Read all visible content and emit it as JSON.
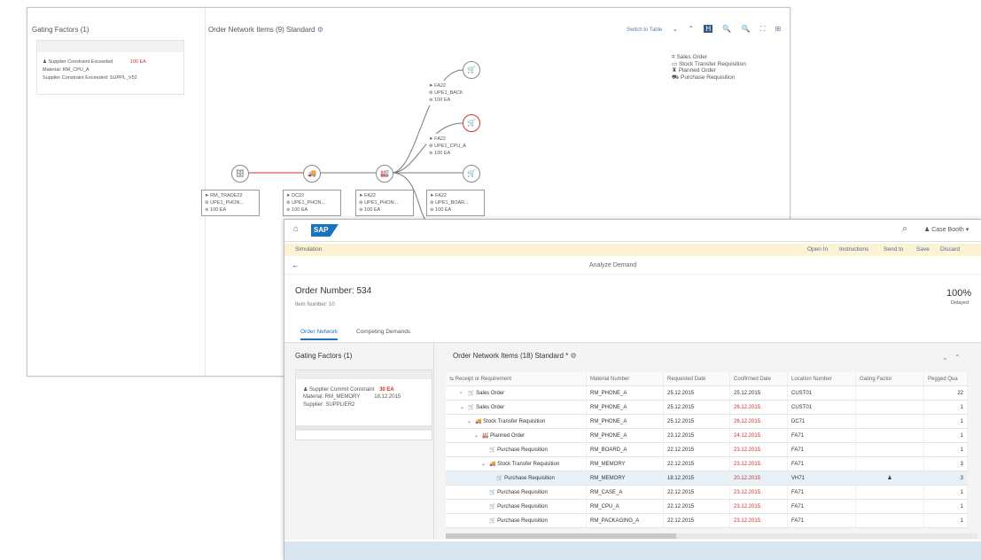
{
  "back": {
    "gating_title": "Gating Factors (1)",
    "gating_item": {
      "line1": "Supplier Constraint Exceeded",
      "value": "100 EA",
      "line2": "Material: RM_CPU_A",
      "line3": "Supplier Constraint Exceeded: SUPPL_V52"
    },
    "network_title": "Order Network Items (9)   Standard",
    "tools": [
      "Switch to Table",
      "⌄",
      "⌃",
      "H",
      "🔍",
      "🔍",
      "⛶",
      "⊞"
    ],
    "legend": [
      "Sales Order",
      "Stock Transfer Requisition",
      "Planned Order",
      "Purchase Requisition"
    ],
    "nodes": [
      {
        "icon": "🗄",
        "loc": "RM_TRADE22",
        "mat": "UPE1_PHON...",
        "qty": "100 EA"
      },
      {
        "icon": "🚚",
        "loc": "DC22",
        "mat": "UPE1_PHON...",
        "qty": "100 EA"
      },
      {
        "icon": "🏭",
        "loc": "FA22",
        "mat": "UPE1_PHON...",
        "qty": "100 EA"
      },
      {
        "icon": "🛒",
        "loc": "FA22",
        "mat": "UPE1_BACK",
        "qty": "100 EA"
      },
      {
        "icon": "🛒",
        "loc": "FA22",
        "mat": "UPE1_CPU_A",
        "qty": "100 EA"
      },
      {
        "icon": "🛒",
        "loc": "FA22",
        "mat": "UPE1_BOAR...",
        "qty": "100 EA"
      }
    ]
  },
  "front": {
    "user": "Case Booth",
    "subbar_left": "Simulation",
    "subbar_actions": [
      "Open In",
      "Instructions",
      "Send to",
      "Save",
      "Discard"
    ],
    "page_title": "Analyze Demand",
    "order_number": "Order Number: 534",
    "item_number": "Item Number: 10",
    "percent": "100%",
    "percent_label": "Delayed",
    "tabs": [
      "Order Network",
      "Competing Demands"
    ],
    "gating_title": "Gating Factors (1)",
    "gating_item": {
      "line1": "Supplier Commit Constraint",
      "value": "30 EA",
      "line2": "Material: RM_MEMORY",
      "date": "18.12.2015",
      "line3": "Supplier: SUPPLIER2"
    },
    "network_title": "Order Network Items (18)   Standard *",
    "table": {
      "headers": [
        "Receipt or Requirement",
        "Material Number",
        "Requested Date",
        "Confirmed Date",
        "Location Number",
        "Gating Factor",
        "Pegged Qua"
      ],
      "rows": [
        {
          "indent": 1,
          "exp": "›",
          "icon": "🛒",
          "name": "Sales Order",
          "mat": "RM_PHONE_A",
          "req": "25.12.2015",
          "conf": "25.12.2015",
          "red": false,
          "loc": "CUST01",
          "gate": "",
          "qty": "22"
        },
        {
          "indent": 1,
          "exp": "⌄",
          "icon": "🛒",
          "name": "Sales Order",
          "mat": "RM_PHONE_A",
          "req": "25.12.2015",
          "conf": "26.12.2015",
          "red": true,
          "loc": "CUST01",
          "gate": "",
          "qty": "1"
        },
        {
          "indent": 2,
          "exp": "⌄",
          "icon": "🚚",
          "name": "Stock Transfer Requisition",
          "mat": "RM_PHONE_A",
          "req": "25.12.2015",
          "conf": "26.12.2015",
          "red": true,
          "loc": "DC71",
          "gate": "",
          "qty": "1"
        },
        {
          "indent": 3,
          "exp": "⌄",
          "icon": "🏭",
          "name": "Planned Order",
          "mat": "RM_PHONE_A",
          "req": "23.12.2015",
          "conf": "24.12.2015",
          "red": true,
          "loc": "FA71",
          "gate": "",
          "qty": "1"
        },
        {
          "indent": 4,
          "exp": "",
          "icon": "🛒",
          "name": "Purchase Requisition",
          "mat": "RM_BOARD_A",
          "req": "22.12.2015",
          "conf": "23.12.2015",
          "red": true,
          "loc": "FA71",
          "gate": "",
          "qty": "1"
        },
        {
          "indent": 4,
          "exp": "⌄",
          "icon": "🚚",
          "name": "Stock Transfer Requisition",
          "mat": "RM_MEMORY",
          "req": "22.12.2015",
          "conf": "23.12.2015",
          "red": true,
          "loc": "FA71",
          "gate": "",
          "qty": "3"
        },
        {
          "indent": 5,
          "exp": "",
          "icon": "🛒",
          "name": "Purchase Requisition",
          "mat": "RM_MEMORY",
          "req": "18.12.2015",
          "conf": "20.12.2015",
          "red": true,
          "loc": "VH71",
          "gate": "♟",
          "qty": "3",
          "hl": true
        },
        {
          "indent": 4,
          "exp": "",
          "icon": "🛒",
          "name": "Purchase Requisition",
          "mat": "RM_CASE_A",
          "req": "22.12.2015",
          "conf": "23.12.2015",
          "red": true,
          "loc": "FA71",
          "gate": "",
          "qty": "1"
        },
        {
          "indent": 4,
          "exp": "",
          "icon": "🛒",
          "name": "Purchase Requisition",
          "mat": "RM_CPU_A",
          "req": "22.12.2015",
          "conf": "23.12.2015",
          "red": true,
          "loc": "FA71",
          "gate": "",
          "qty": "1"
        },
        {
          "indent": 4,
          "exp": "",
          "icon": "🛒",
          "name": "Purchase Requisition",
          "mat": "RM_PACKAGING_A",
          "req": "22.12.2015",
          "conf": "23.12.2015",
          "red": true,
          "loc": "FA71",
          "gate": "",
          "qty": "1"
        }
      ]
    }
  },
  "colors": {
    "accent": "#1a73c0",
    "negative": "#cc3322",
    "link_edge": "#cc3333"
  }
}
